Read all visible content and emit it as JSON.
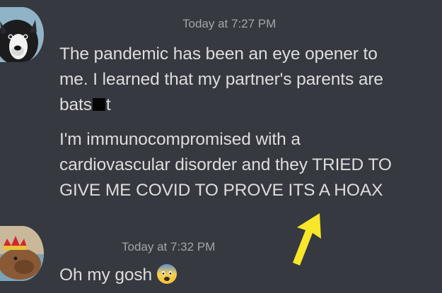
{
  "messages": [
    {
      "timestamp": "Today at 7:27 PM",
      "avatar_icon": "dog-avatar-icon",
      "paragraphs": [
        {
          "lines": [
            "The pandemic has been an eye opener to",
            "me. I learned that my partner's parents are"
          ],
          "censored_line": {
            "before": "bats",
            "after": "t"
          }
        },
        {
          "lines": [
            "I'm immunocompromised with a",
            "cardiovascular disorder and they TRIED TO",
            "GIVE ME COVID TO PROVE ITS A HOAX"
          ]
        }
      ]
    },
    {
      "timestamp": "Today at 7:32 PM",
      "avatar_icon": "capybara-crown-avatar-icon",
      "text": "Oh my gosh",
      "emoji": "fearful-face-emoji-icon"
    }
  ],
  "overlay": {
    "arrow_icon": "yellow-arrow-icon",
    "arrow_color": "#f7e62a"
  },
  "colors": {
    "background": "#36393f",
    "message_text": "#dcddde",
    "timestamp_text": "#a3a6aa"
  }
}
